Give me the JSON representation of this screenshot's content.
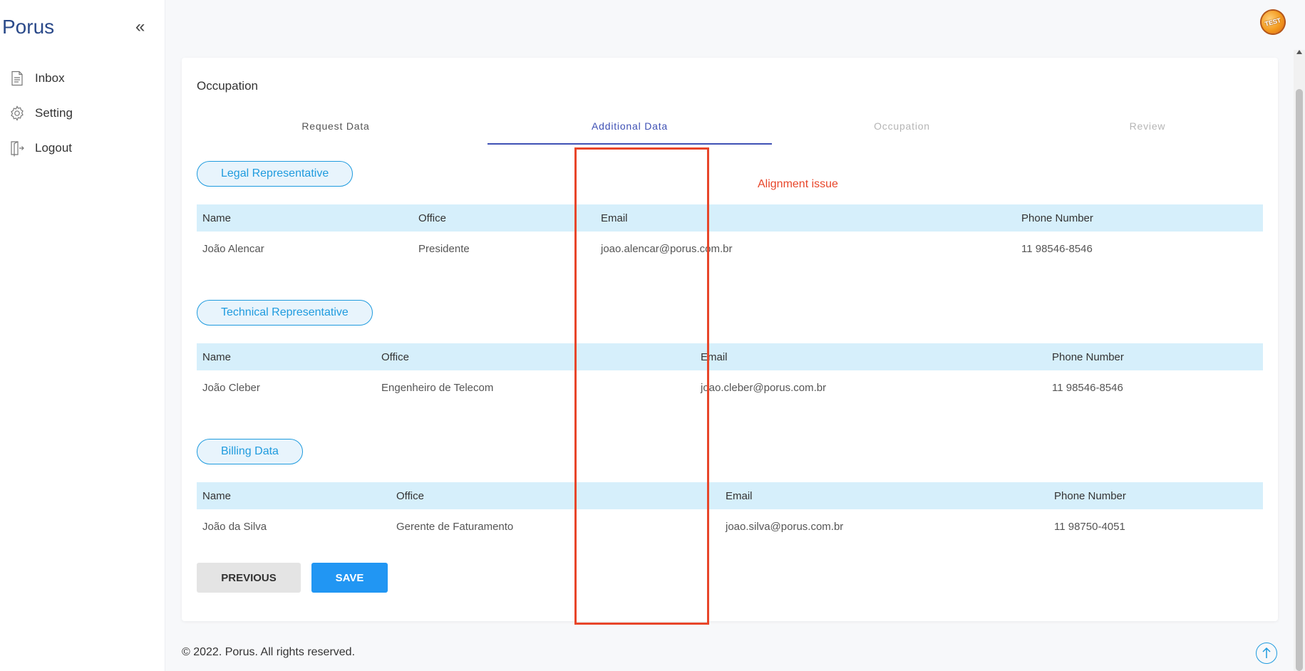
{
  "app": {
    "brand": "Porus",
    "collapse_glyph": "«"
  },
  "sidebar": {
    "items": [
      {
        "label": "Inbox",
        "icon": "document-icon"
      },
      {
        "label": "Setting",
        "icon": "gear-icon"
      },
      {
        "label": "Logout",
        "icon": "logout-icon"
      }
    ]
  },
  "header": {
    "avatar_text": "TEST"
  },
  "page": {
    "title": "Occupation",
    "steps": [
      {
        "label": "Request Data",
        "state": "done"
      },
      {
        "label": "Additional Data",
        "state": "active"
      },
      {
        "label": "Occupation",
        "state": "pending"
      },
      {
        "label": "Review",
        "state": "pending"
      }
    ]
  },
  "sections": [
    {
      "title": "Legal Representative",
      "headers": [
        "Name",
        "Office",
        "Email",
        "Phone Number"
      ],
      "rows": [
        [
          "João Alencar",
          "Presidente",
          "joao.alencar@porus.com.br",
          "11 98546-8546"
        ]
      ]
    },
    {
      "title": "Technical Representative",
      "headers": [
        "Name",
        "Office",
        "Email",
        "Phone Number"
      ],
      "rows": [
        [
          "João Cleber",
          "Engenheiro de Telecom",
          "joao.cleber@porus.com.br",
          "11 98546-8546"
        ]
      ]
    },
    {
      "title": "Billing Data",
      "headers": [
        "Name",
        "Office",
        "Email",
        "Phone Number"
      ],
      "rows": [
        [
          "João da Silva",
          "Gerente de Faturamento",
          "joao.silva@porus.com.br",
          "11 98750-4051"
        ]
      ]
    }
  ],
  "actions": {
    "previous": "PREVIOUS",
    "save": "SAVE"
  },
  "annotation": {
    "text": "Alignment issue",
    "color": "#e8462a"
  },
  "footer": {
    "text": "© 2022. Porus. All rights reserved."
  },
  "colors": {
    "brand": "#2b4a8a",
    "accent": "#1f9bde",
    "step_active": "#3f51b5",
    "save_button": "#2196f3",
    "table_header": "#d6effb"
  }
}
